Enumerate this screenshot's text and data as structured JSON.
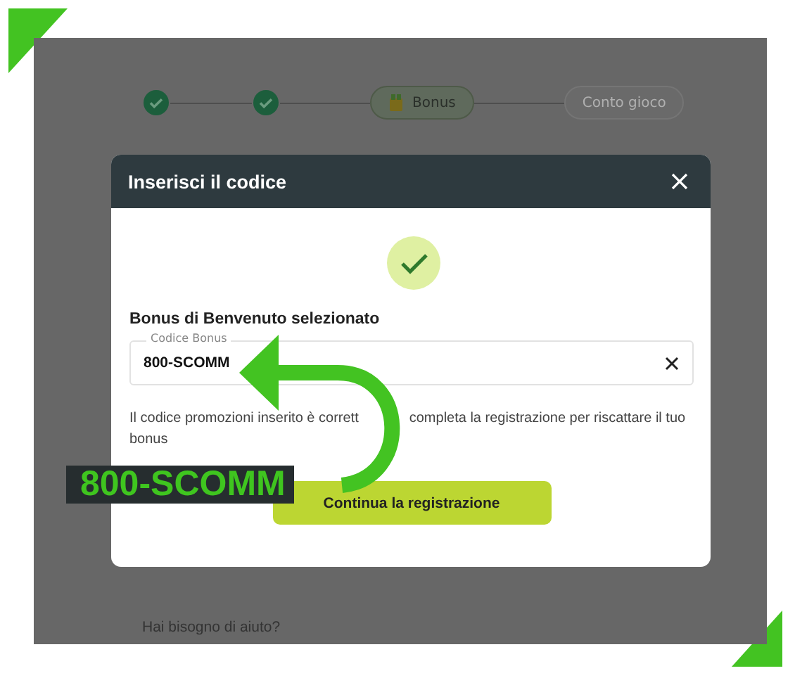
{
  "steps": [
    {
      "kind": "done"
    },
    {
      "kind": "done"
    },
    {
      "kind": "current",
      "label": "Bonus"
    },
    {
      "kind": "pending",
      "label": "Conto gioco"
    }
  ],
  "dialog": {
    "title": "Inserisci il codice",
    "heading": "Bonus di Benvenuto selezionato",
    "field": {
      "label": "Codice Bonus",
      "value": "800-SCOMM"
    },
    "message_parts": [
      "Il codice promozioni inserito è corrett",
      "completa la registrazione per riscattare il tuo",
      "bonus"
    ],
    "button": "Continua la registrazione"
  },
  "help_link": "Hai bisogno di aiuto?",
  "annotation": {
    "label": "800-SCOMM"
  }
}
